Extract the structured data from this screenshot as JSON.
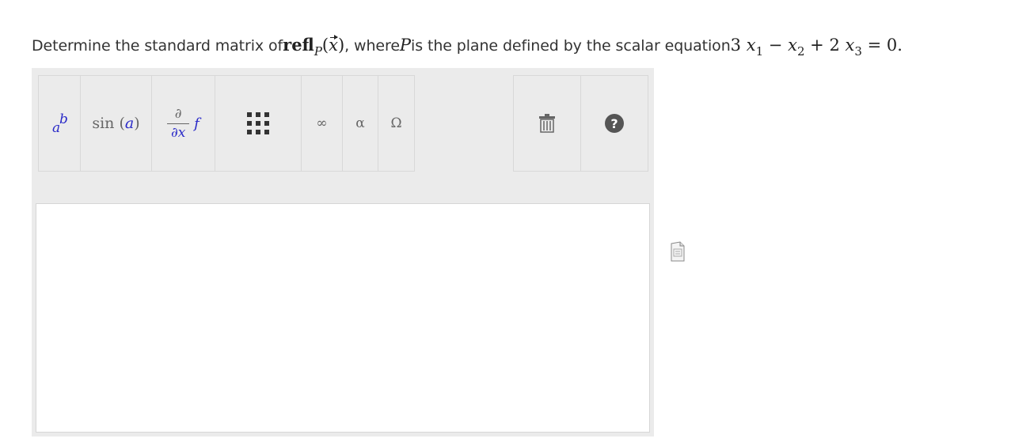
{
  "question": {
    "prefix": "Determine the standard matrix of ",
    "middle": ", where ",
    "middle2": " is the plane defined by the scalar equation ",
    "math": {
      "refl": "refl",
      "sub_P": "P",
      "paren_open": "(",
      "x": "x",
      "paren_close": ")",
      "P": "P",
      "c1": "3",
      "x1": "x",
      "i1": "1",
      "minus": "−",
      "x2": "x",
      "i2": "2",
      "plus": "+",
      "c3": "2",
      "x3": "x",
      "i3": "3",
      "eq": "=",
      "rhs": "0."
    }
  },
  "toolbar": {
    "power": {
      "base": "a",
      "exp": "b"
    },
    "sin": {
      "fn": "sin",
      "open": "(",
      "arg": "a",
      "close": ")"
    },
    "derivative": {
      "num": "∂",
      "den": "∂x",
      "fn": "f"
    },
    "infinity": "∞",
    "alpha": "α",
    "omega": "Ω",
    "help": "?"
  },
  "icons": {
    "power": "superscript-icon",
    "sin": "function-icon",
    "derivative": "derivative-icon",
    "matrix": "matrix-icon",
    "infinity": "infinity-icon",
    "alpha": "greek-letter-icon",
    "omega": "symbol-icon",
    "trash": "trash-icon",
    "help": "help-icon",
    "side": "document-icon"
  },
  "colors": {
    "toolbar_bg": "#ebebeb",
    "variable_blue": "#2a2ac8",
    "help_bg": "#555555"
  }
}
